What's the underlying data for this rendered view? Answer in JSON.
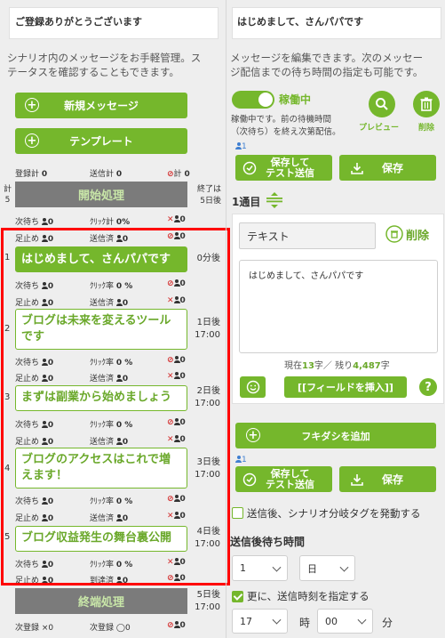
{
  "left": {
    "header": "ご登録ありがとうございます",
    "description_line1": "シナリオ内のメッセージをお手軽管理。ス",
    "description_line2": "テータスを確認することもできます。",
    "new_message_label": "新規メッセージ",
    "template_label": "テンプレート",
    "summary": {
      "registered_label": "登録計",
      "registered_value": "0",
      "sent_label": "送信計",
      "sent_value": "0",
      "blocked_label": "計",
      "blocked_value": "0"
    },
    "start": {
      "side_label": "計",
      "side_value": "5",
      "bar_label": "開始処理",
      "end_label": "終了は",
      "end_value": "5日後",
      "row1": {
        "next_label": "次待ち",
        "next_value": "0",
        "click_label": "ｸﾘｯｸ計",
        "click_value": "0%",
        "x_value": "0"
      },
      "row2": {
        "stop_label": "足止め",
        "stop_value": "0",
        "sent_label": "送信済",
        "sent_value": "0",
        "block_value": "0"
      }
    },
    "messages": [
      {
        "index": "1",
        "title": "はじめまして、さんパパです",
        "time1": "0分後",
        "time2": "",
        "row1": {
          "next_label": "次待ち",
          "next_value": "0",
          "click_label": "ｸﾘｯｸ率",
          "click_value": "0 %",
          "block_value": "0"
        },
        "row2": {
          "stop_label": "足止め",
          "stop_value": "0",
          "sent_label": "送信済",
          "sent_value": "0",
          "x_value": "0"
        }
      },
      {
        "index": "2",
        "title": "ブログは未来を変えるツールです",
        "time1": "1日後",
        "time2": "17:00",
        "row1": {
          "next_label": "次待ち",
          "next_value": "0",
          "click_label": "ｸﾘｯｸ率",
          "click_value": "0 %",
          "block_value": "0"
        },
        "row2": {
          "stop_label": "足止め",
          "stop_value": "0",
          "sent_label": "送信済",
          "sent_value": "0",
          "x_value": "0"
        }
      },
      {
        "index": "3",
        "title": "まずは副業から始めましょう",
        "time1": "2日後",
        "time2": "17:00",
        "row1": {
          "next_label": "次待ち",
          "next_value": "0",
          "click_label": "ｸﾘｯｸ率",
          "click_value": "0 %",
          "block_value": "0"
        },
        "row2": {
          "stop_label": "足止め",
          "stop_value": "0",
          "sent_label": "送信済",
          "sent_value": "0",
          "x_value": "0"
        }
      },
      {
        "index": "4",
        "title": "ブログのアクセスはこれで増えます！",
        "time1": "3日後",
        "time2": "17:00",
        "row1": {
          "next_label": "次待ち",
          "next_value": "0",
          "click_label": "ｸﾘｯｸ率",
          "click_value": "0 %",
          "block_value": "0"
        },
        "row2": {
          "stop_label": "足止め",
          "stop_value": "0",
          "sent_label": "送信済",
          "sent_value": "0",
          "x_value": "0"
        }
      },
      {
        "index": "5",
        "title": "ブログ収益発生の舞台裏公開",
        "time1": "4日後",
        "time2": "17:00",
        "row1": {
          "next_label": "次待ち",
          "next_value": "0",
          "click_label": "ｸﾘｯｸ率",
          "click_value": "0 %",
          "x_value": "0"
        },
        "row2": {
          "stop_label": "足止め",
          "stop_value": "0",
          "sent_label": "到達済",
          "sent_value": "0",
          "block_value": "0"
        }
      }
    ],
    "end": {
      "bar_label": "終端処理",
      "time1": "5日後",
      "time2": "17:00",
      "row": {
        "a_label": "次登録",
        "a_value": "×0",
        "b_label": "次登録",
        "b_value": "◯0",
        "c_value": "0"
      }
    }
  },
  "right": {
    "header": "はじめまして、さんパパです",
    "description_line1": "メッセージを編集できます。次のメッセー",
    "description_line2": "ジ配信までの待ち時間の指定も可能です。",
    "status_label": "稼働中",
    "status_note1": "稼働中です。前の待機時間",
    "status_note2": "（次待ち）を終え次第配信。",
    "preview_label": "プレビュー",
    "delete_label": "削除",
    "user_count": "1",
    "save_test_label1": "保存して",
    "save_test_label2": "テスト送信",
    "save_label": "保存",
    "item_label": "1通目",
    "type_value": "テキスト",
    "delete_text_label": "削除",
    "message_body": "はじめまして、さんパパです",
    "count_prefix": "現在",
    "count_current": "13",
    "count_mid": "字／ 残り",
    "count_remaining": "4,487",
    "count_suffix": "字",
    "insert_field_label": "[[フィールドを挿入]]",
    "add_bubble_label": "フキダシを追加",
    "user_count2": "1",
    "branch_tag_label": "送信後、シナリオ分岐タグを発動する",
    "wait_time_heading": "送信後待ち時間",
    "wait_number": "1",
    "wait_unit": "日",
    "specify_time_label": "更に、送信時刻を指定する",
    "hour_value": "17",
    "hour_label": "時",
    "minute_value": "00",
    "minute_label": "分"
  }
}
